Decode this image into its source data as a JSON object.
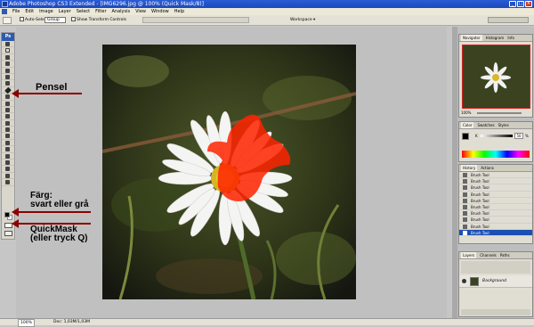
{
  "window": {
    "title": "Adobe Photoshop CS3 Extended - [IMG6296.jpg @ 100% (Quick Mask/8)]",
    "minimize": "_",
    "maximize": "□",
    "close": "×"
  },
  "menu": [
    "File",
    "Edit",
    "Image",
    "Layer",
    "Select",
    "Filter",
    "Analysis",
    "View",
    "Window",
    "Help"
  ],
  "options": {
    "auto_select_label": "Auto-Select:",
    "auto_select_value": "Group",
    "show_transform_label": "Show Transform Controls",
    "workspace_label": "Workspace ▾"
  },
  "annotations": {
    "pensel": "Pensel",
    "farg_line1": "Färg:",
    "farg_line2": "svart eller grå",
    "quickmask_line1": "QuickMask",
    "quickmask_line2": "(eller tryck Q)"
  },
  "navigator": {
    "tabs": [
      "Navigator",
      "Histogram",
      "Info"
    ],
    "zoom": "100%"
  },
  "color_panel": {
    "tabs": [
      "Color",
      "Swatches",
      "Styles"
    ],
    "k_label": "K",
    "k_value": "50",
    "k_unit": "%"
  },
  "history": {
    "tabs": [
      "History",
      "Actions"
    ],
    "items": [
      "Brush Tool",
      "Brush Tool",
      "Brush Tool",
      "Brush Tool",
      "Brush Tool",
      "Brush Tool",
      "Brush Tool",
      "Brush Tool",
      "Brush Tool",
      "Brush Tool"
    ]
  },
  "layers": {
    "tabs": [
      "Layers",
      "Channels",
      "Paths"
    ],
    "layer_name": "Background"
  },
  "status": {
    "zoom": "100%",
    "doc": "Doc: 1,03M/1,03M"
  },
  "colors": {
    "accent_arrow": "#8b0000",
    "quickmask_red": "#ff2200",
    "selection_blue": "#1b4fb4"
  }
}
